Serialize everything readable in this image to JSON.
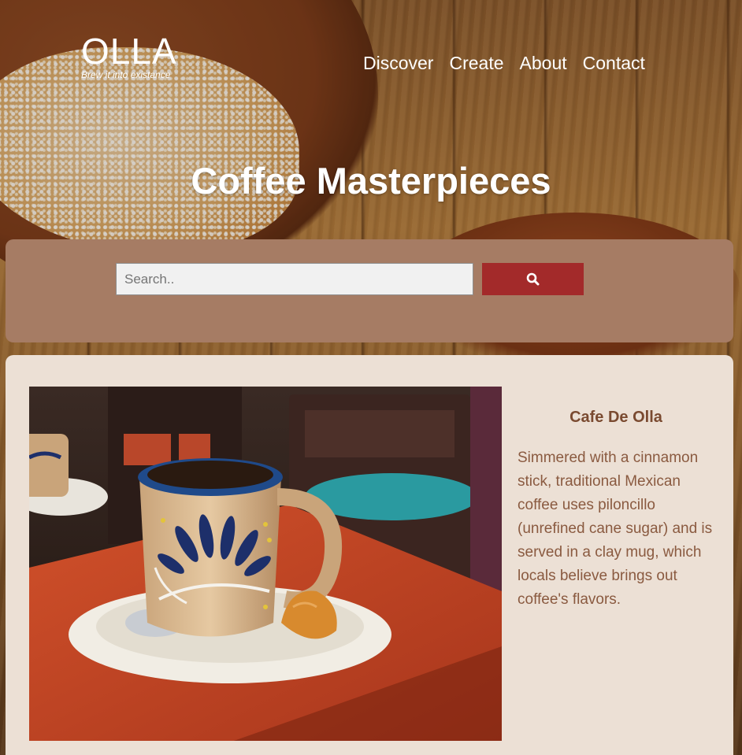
{
  "header": {
    "brand_name": "OLLA",
    "tagline": "Brew it into existance",
    "nav": [
      {
        "label": "Discover"
      },
      {
        "label": "Create"
      },
      {
        "label": "About"
      },
      {
        "label": "Contact"
      }
    ]
  },
  "hero": {
    "title": "Coffee Masterpieces"
  },
  "search": {
    "placeholder": "Search..",
    "button_icon": "search-icon",
    "button_color": "#a32a2a"
  },
  "featured": {
    "title": "Cafe De Olla",
    "description": "Simmered with a cinnamon stick, traditional Mexican coffee uses piloncillo (unrefined cane sugar) and is served in a clay mug, which locals believe brings out coffee's flavors."
  },
  "colors": {
    "search_panel": "#a67c64",
    "card_background": "#ece0d5",
    "card_title": "#7a4a30",
    "card_text": "#8a5a40"
  }
}
